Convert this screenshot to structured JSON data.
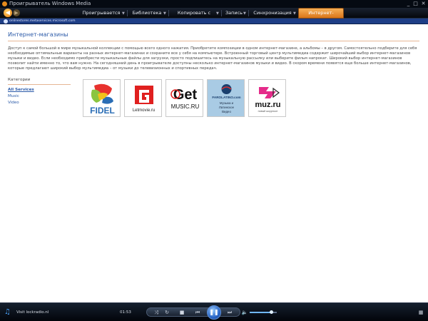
{
  "window": {
    "title": "Проигрыватель Windows Media"
  },
  "nav": {
    "tabs": [
      {
        "label": "Проигрывается"
      },
      {
        "label": "Библиотека"
      },
      {
        "label": "Копировать с диска"
      },
      {
        "label": "Запись"
      },
      {
        "label": "Синхронизация"
      },
      {
        "label": "Интернет-магазины"
      }
    ],
    "active_tab": "Интернет-магазины"
  },
  "address": {
    "text": "onlinestores.metaservices.microsoft.com"
  },
  "page": {
    "title": "Интернет-магазины",
    "description": "Доступ к самой большой в мире музыкальной коллекции с помощью всего одного нажатия. Приобретите композиции в одном интернет-магазине, а альбомы – в другом. Самостоятельно подберите для себя необходимые оптимальные варианты на разных интернет-магазинах и сохраните все у себя на компьютере. Встроенный торговый центр мультимедиа содержит широчайший выбор интернет-магазинов музыки и видео. Если необходимо приобрести музыкальные файлы для загрузки, просто подпишитесь на музыкальную рассылку или выберите фильм напрокат. Широкий выбор интернет-магазинов позволит найти именно то, что вам нужно. На сегодняшний день в проигрывателе доступны несколько интернет-магазинов музыки и видео. В скором времени появятся еще больше интернет-магазинов, которые предлагают широкий выбор мультимедиа – от музыки до телевизионных и спортивных передач."
  },
  "categories": {
    "heading": "Категории",
    "items": [
      {
        "label": "All Services",
        "active": true
      },
      {
        "label": "Music",
        "active": false
      },
      {
        "label": "Video",
        "active": false
      }
    ]
  },
  "stores": [
    {
      "name": "FIDEL",
      "logo_text": "FIDEL",
      "colors": [
        "#8bc540",
        "#e8322e",
        "#2a6db5"
      ]
    },
    {
      "name": "Letmovie.ru",
      "logo_text": "Letmovie.ru",
      "colors": [
        "#e0201f"
      ]
    },
    {
      "name": "Get Music.ru",
      "logo_text_top": "Get",
      "logo_text_bottom": "MUSIC.RU",
      "colors": [
        "#111111"
      ]
    },
    {
      "name": "Farolatino",
      "logo_text": "FAROLATINO.com",
      "caption_lines": [
        "Музыка и",
        "Латинское",
        "Видео"
      ],
      "colors": [
        "#a9cbe4"
      ]
    },
    {
      "name": "muz.ru",
      "logo_text": "muz.ru",
      "tagline": "новый шоурноот",
      "colors": [
        "#e52b8a"
      ]
    }
  ],
  "player": {
    "status": "Visit lockradio.nl",
    "time": "01:53",
    "volume_fraction": 0.8,
    "icons": {
      "media": "music-note-icon",
      "shuffle": "shuffle-icon",
      "repeat": "repeat-icon",
      "stop": "stop-icon",
      "prev": "previous-icon",
      "play": "pause-icon",
      "next": "next-icon",
      "mute": "speaker-icon",
      "grid": "grid-icon"
    }
  }
}
